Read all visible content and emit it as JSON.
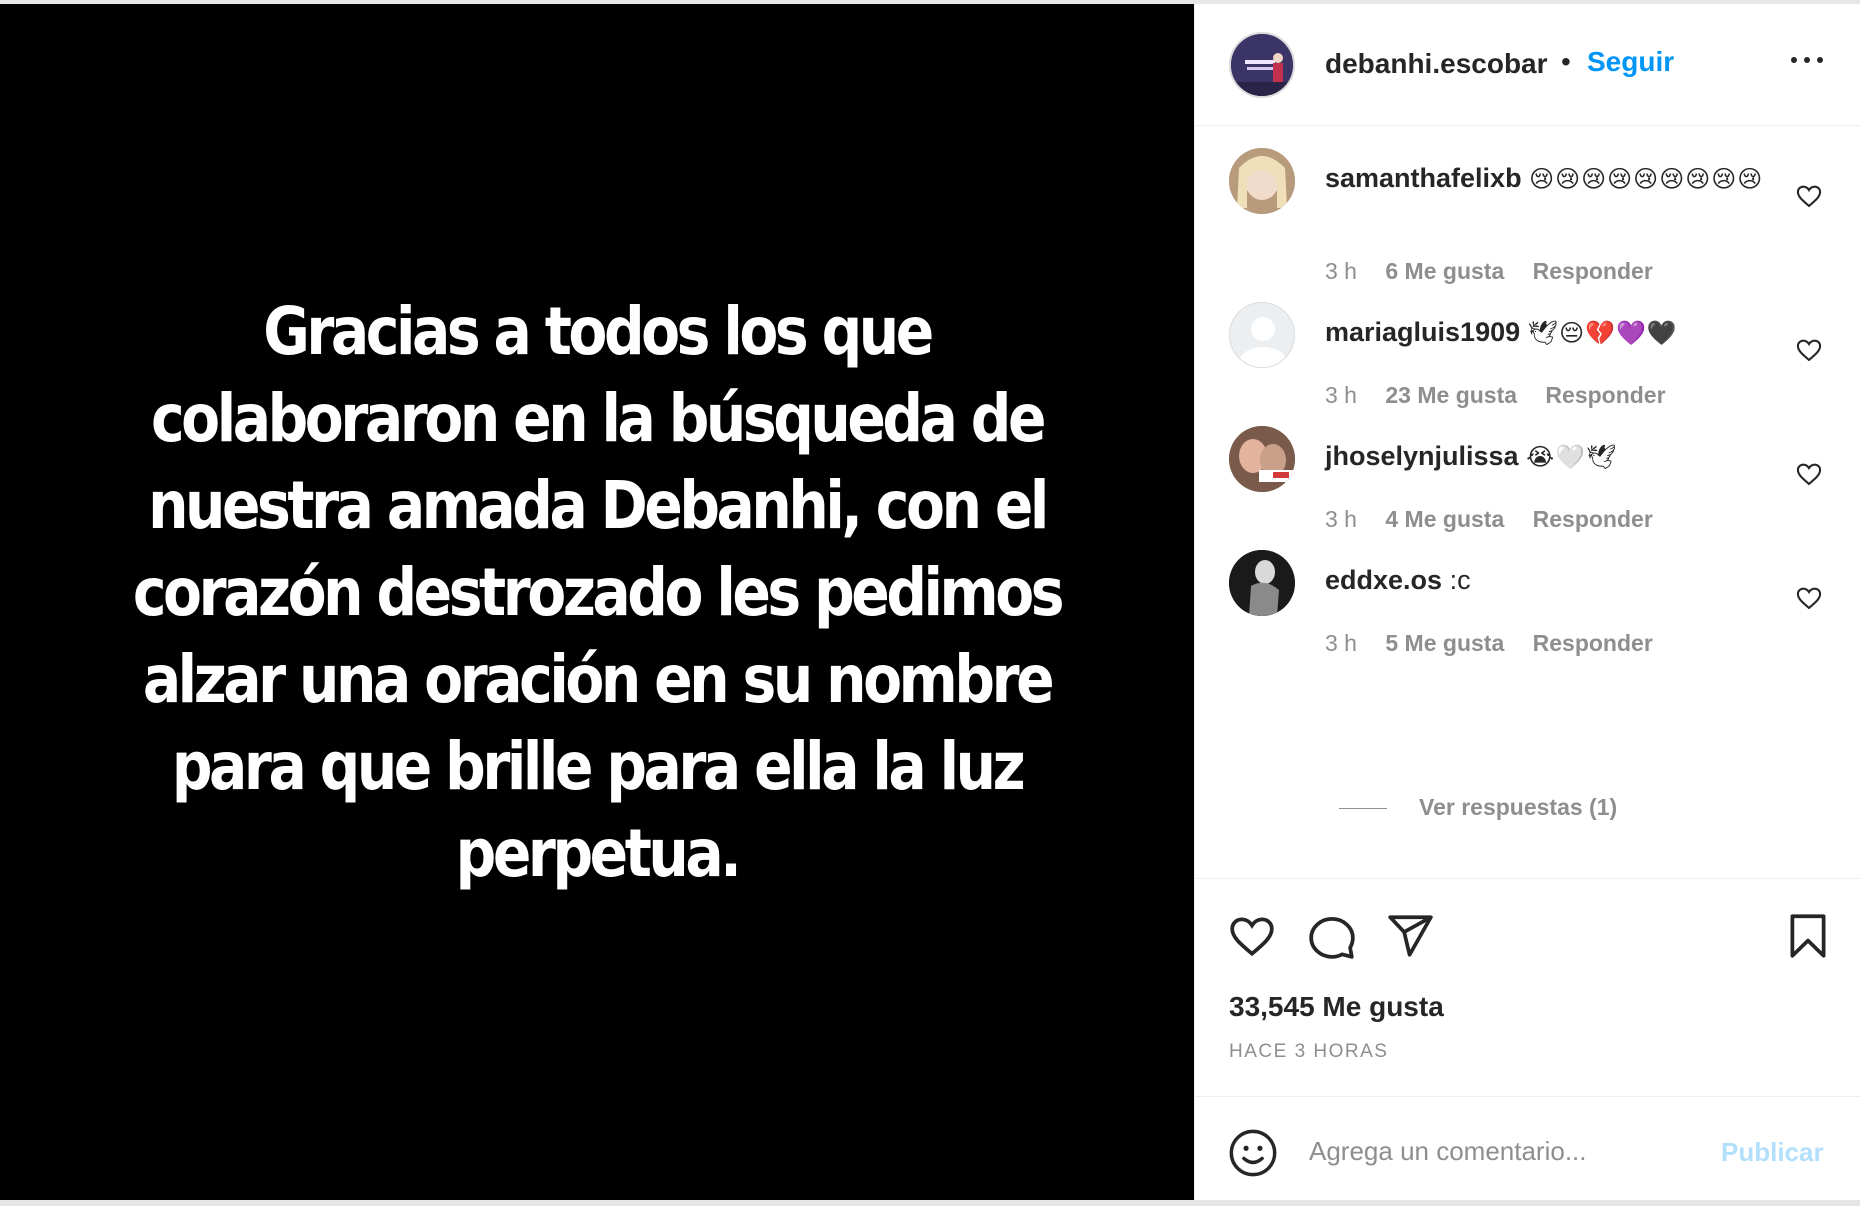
{
  "post": {
    "image_text": "Gracias a todos los que colaboraron en la búsqueda de nuestra amada Debanhi, con el corazón destrozado les pedimos alzar una oración en su nombre para que brille para ella la luz perpetua."
  },
  "header": {
    "username": "debanhi.escobar",
    "separator": "•",
    "follow_label": "Seguir",
    "more_icon": "more-horizontal-icon"
  },
  "comments": [
    {
      "username": "samanthafelixb",
      "text": "😢😢😢😢😢😢😢😢😢",
      "time": "3 h",
      "likes": "6 Me gusta",
      "reply_label": "Responder"
    },
    {
      "username": "mariagluis1909",
      "text": "🕊😔💔💜🖤",
      "time": "3 h",
      "likes": "23 Me gusta",
      "reply_label": "Responder"
    },
    {
      "username": "jhoselynjulissa",
      "text": "😭🤍🕊",
      "time": "3 h",
      "likes": "4 Me gusta",
      "reply_label": "Responder"
    },
    {
      "username": "eddxe.os",
      "text": ":c",
      "time": "3 h",
      "likes": "5 Me gusta",
      "reply_label": "Responder"
    }
  ],
  "replies": {
    "label": "Ver respuestas (1)"
  },
  "actions": {
    "likes_count": "33,545 Me gusta",
    "timestamp": "HACE 3 HORAS"
  },
  "add_comment": {
    "placeholder": "Agrega un comentario...",
    "publish_label": "Publicar"
  },
  "colors": {
    "link_blue": "#0095f6",
    "publish_disabled": "#b2dffc",
    "secondary_text": "#8e8e8e",
    "primary_text": "#262626"
  }
}
